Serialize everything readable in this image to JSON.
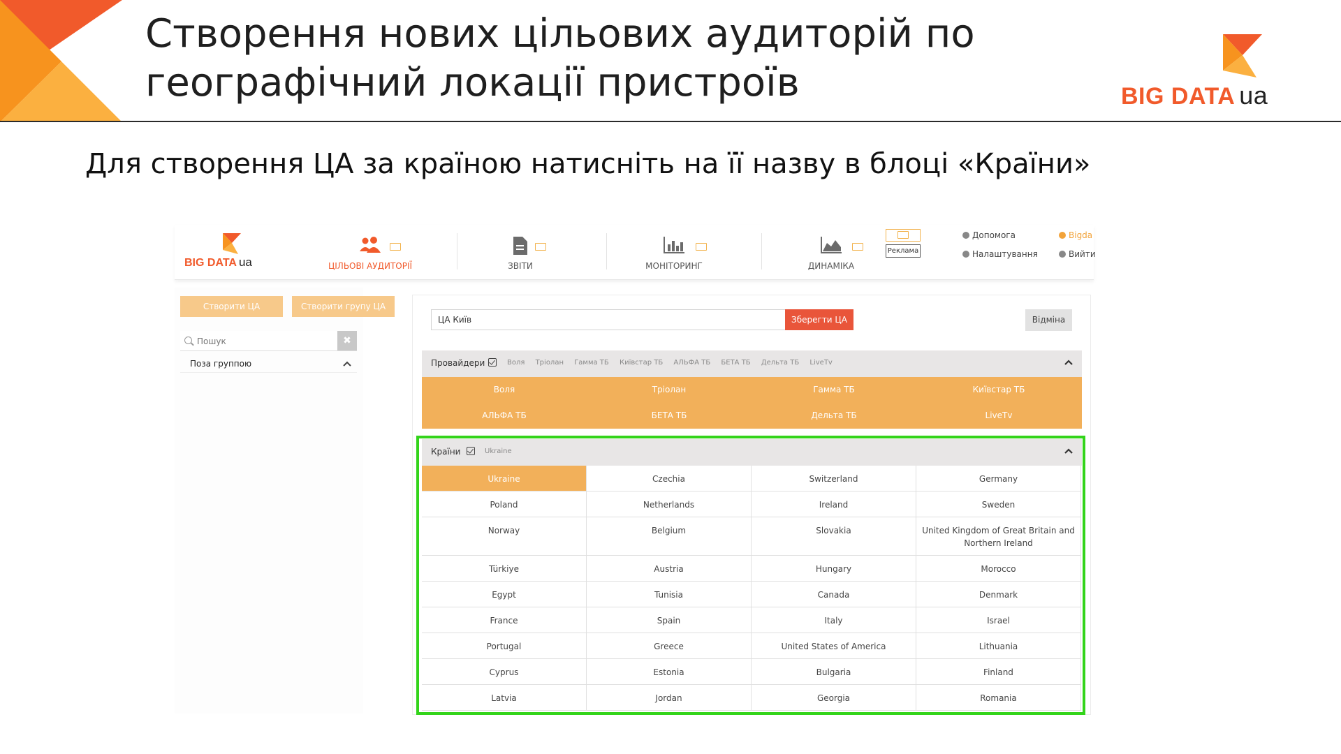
{
  "slide": {
    "title_line1": "Створення нових цільових аудиторій по",
    "title_line2": "географічний локації пристроїв",
    "subtitle": "Для створення ЦА за країною натисніть на її назву в блоці «Країни»",
    "logo": {
      "word": "BIG DATA",
      "suffix": "ua"
    },
    "colors": {
      "accent": "#f15a2b",
      "orange": "#f2b05a",
      "highlight": "#33d41a"
    }
  },
  "app": {
    "logo": {
      "word": "BIG DATA",
      "suffix": "ua"
    },
    "nav": [
      {
        "label": "ЦІЛЬОВІ АУДИТОРІЇ",
        "icon": "users-icon",
        "active": true
      },
      {
        "label": "ЗВІТИ",
        "icon": "document-icon",
        "active": false
      },
      {
        "label": "МОНІТОРИНГ",
        "icon": "bar-chart-icon",
        "active": false
      },
      {
        "label": "ДИНАМІКА",
        "icon": "area-chart-icon",
        "active": false
      }
    ],
    "ad_button": "Реклама",
    "links": {
      "help": "Допомога",
      "settings": "Налаштування",
      "user": "Bigda",
      "logout": "Вийти"
    },
    "sidebar": {
      "create_ca": "Створити ЦА",
      "create_group": "Створити групу ЦА",
      "search_placeholder": "Пошук",
      "clear": "✖",
      "group": "Поза группою"
    },
    "main": {
      "name_value": "ЦА Київ",
      "save": "Зберегти ЦА",
      "cancel": "Відміна",
      "providers": {
        "title": "Провайдери",
        "chips": [
          "Воля",
          "Тріолан",
          "Гамма ТБ",
          "Київстар ТБ",
          "АЛЬФА ТБ",
          "БЕТА ТБ",
          "Дельта ТБ",
          "LiveTv"
        ],
        "items": [
          "Воля",
          "Тріолан",
          "Гамма ТБ",
          "Київстар ТБ",
          "АЛЬФА ТБ",
          "БЕТА ТБ",
          "Дельта ТБ",
          "LiveTv"
        ]
      },
      "countries": {
        "title": "Країни",
        "chips": [
          "Ukraine"
        ],
        "selected": "Ukraine",
        "items": [
          "Ukraine",
          "Czechia",
          "Switzerland",
          "Germany",
          "Poland",
          "Netherlands",
          "Ireland",
          "Sweden",
          "Norway",
          "Belgium",
          "Slovakia",
          "United Kingdom of Great Britain and Northern Ireland",
          "Türkiye",
          "Austria",
          "Hungary",
          "Morocco",
          "Egypt",
          "Tunisia",
          "Canada",
          "Denmark",
          "France",
          "Spain",
          "Italy",
          "Israel",
          "Portugal",
          "Greece",
          "United States of America",
          "Lithuania",
          "Cyprus",
          "Estonia",
          "Bulgaria",
          "Finland",
          "Latvia",
          "Jordan",
          "Georgia",
          "Romania"
        ]
      }
    }
  }
}
